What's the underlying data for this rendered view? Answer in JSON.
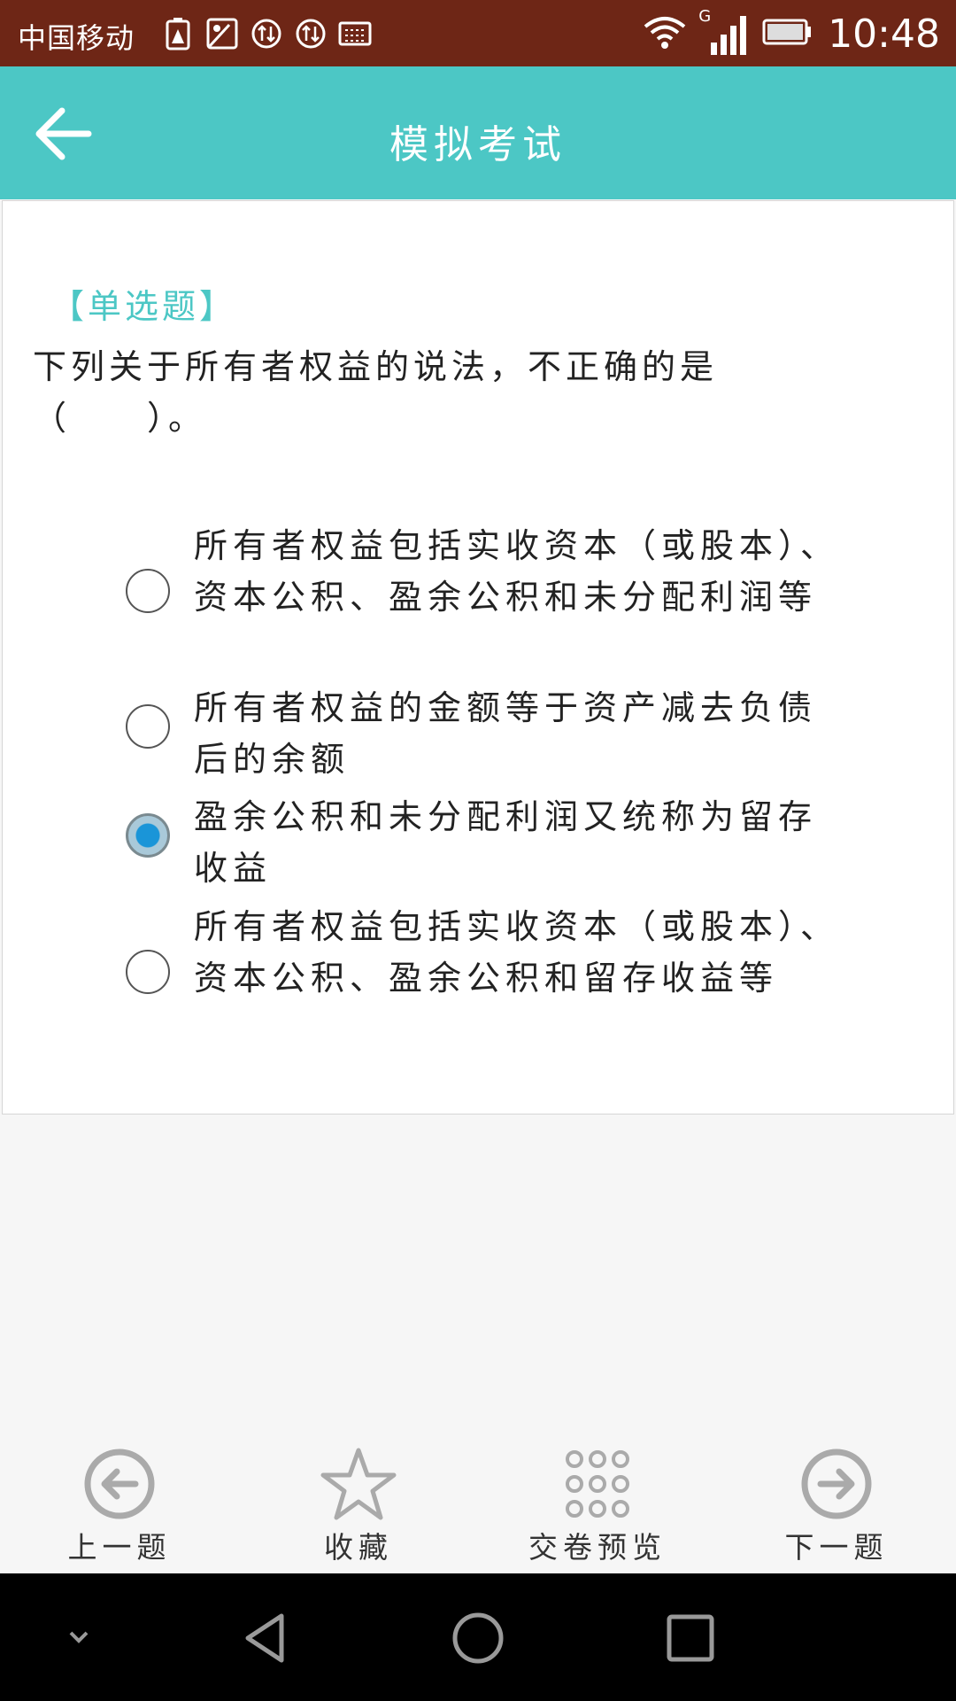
{
  "status_bar": {
    "carrier": "中国移动",
    "time": "10:48",
    "network_label": "G",
    "icons": [
      "battery-warning-icon",
      "image-icon",
      "data-transfer-icon",
      "data-transfer-icon",
      "keyboard-icon",
      "wifi-icon",
      "signal-icon",
      "battery-icon"
    ]
  },
  "app_bar": {
    "title": "模拟考试",
    "back_icon": "back-arrow-icon"
  },
  "question": {
    "type_label": "【单选题】",
    "text": "下列关于所有者权益的说法，不正确的是（　　）。",
    "options": [
      {
        "text": "所有者权益包括实收资本（或股本）、资本公积、盈余公积和未分配利润等",
        "selected": false
      },
      {
        "text": "所有者权益的金额等于资产减去负债后的余额",
        "selected": false
      },
      {
        "text": "盈余公积和未分配利润又统称为留存收益",
        "selected": true
      },
      {
        "text": "所有者权益包括实收资本（或股本）、资本公积、盈余公积和留存收益等",
        "selected": false
      }
    ]
  },
  "bottom_nav": [
    {
      "label": "上一题",
      "icon": "previous-circle-arrow-icon"
    },
    {
      "label": "收藏",
      "icon": "star-icon"
    },
    {
      "label": "交卷预览",
      "icon": "grid-dots-icon"
    },
    {
      "label": "下一题",
      "icon": "next-circle-arrow-icon"
    }
  ],
  "system_nav": [
    "collapse-chevron-icon",
    "back-triangle-icon",
    "home-circle-icon",
    "recents-square-icon"
  ],
  "colors": {
    "accent": "#4cc7c5",
    "status_bar": "#6e2616",
    "radio_selected": "#1a95d8"
  }
}
